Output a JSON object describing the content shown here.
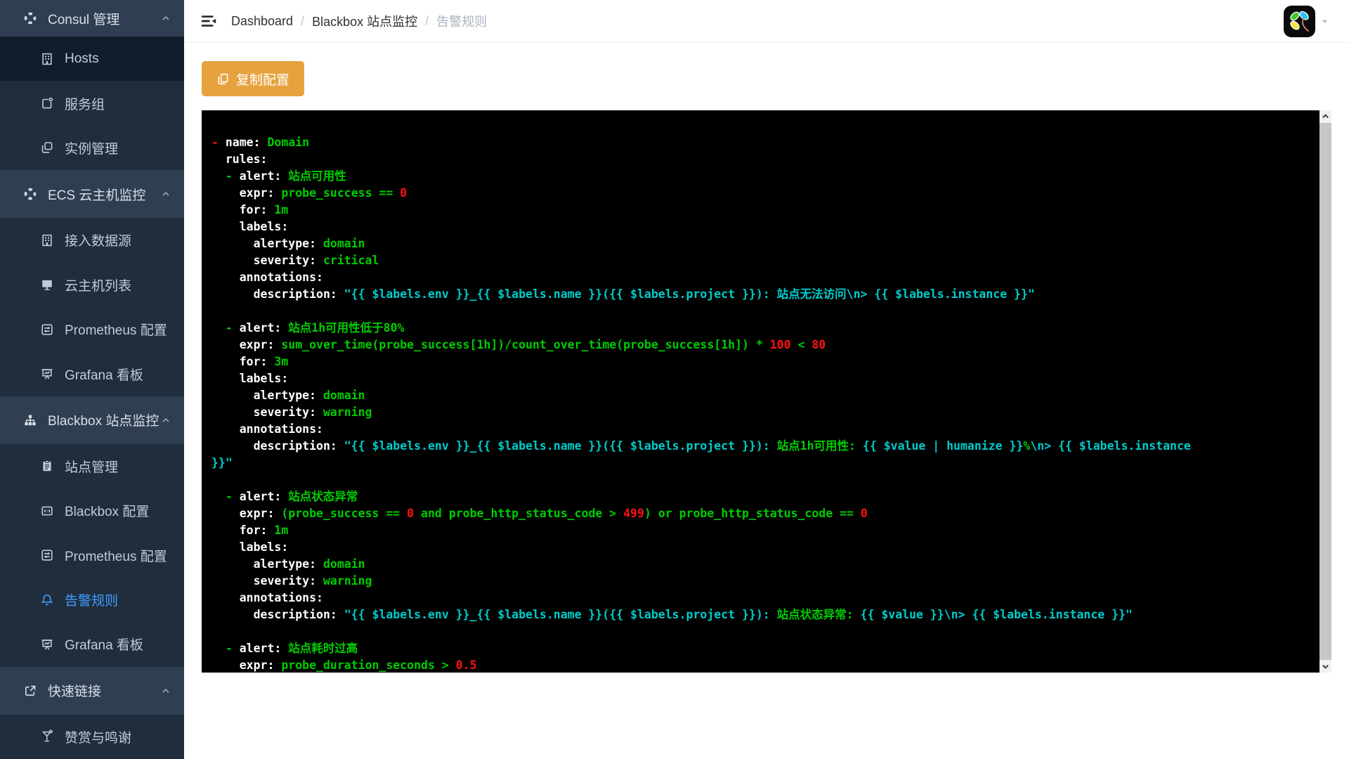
{
  "sidebar": {
    "items": [
      {
        "kind": "header",
        "id": "consul",
        "icon": "lifebuoy-icon",
        "label": "Consul 管理",
        "chevron": true,
        "first": true
      },
      {
        "kind": "item",
        "id": "hosts",
        "icon": "building-icon",
        "label": "Hosts",
        "dark": true
      },
      {
        "kind": "item",
        "id": "service-groups",
        "icon": "tag-icon",
        "label": "服务组"
      },
      {
        "kind": "item",
        "id": "instance-management",
        "icon": "copy-icon",
        "label": "实例管理"
      },
      {
        "kind": "header",
        "id": "ecs",
        "icon": "lifebuoy-icon",
        "label": "ECS 云主机监控",
        "chevron": true
      },
      {
        "kind": "item",
        "id": "datasource-access",
        "icon": "building-icon",
        "label": "接入数据源"
      },
      {
        "kind": "item",
        "id": "host-list",
        "icon": "monitor-icon",
        "label": "云主机列表"
      },
      {
        "kind": "item",
        "id": "prometheus-config-ecs",
        "icon": "sliders-icon",
        "label": "Prometheus 配置"
      },
      {
        "kind": "item",
        "id": "grafana-board-ecs",
        "icon": "board-chart-icon",
        "label": "Grafana 看板"
      },
      {
        "kind": "header",
        "id": "blackbox",
        "icon": "sitemap-icon",
        "label": "Blackbox 站点监控",
        "chevron": true
      },
      {
        "kind": "item",
        "id": "site-management",
        "icon": "clipboard-icon",
        "label": "站点管理"
      },
      {
        "kind": "item",
        "id": "blackbox-config",
        "icon": "blackbox-config-icon",
        "label": "Blackbox 配置"
      },
      {
        "kind": "item",
        "id": "prometheus-config-blackbox",
        "icon": "sliders-icon",
        "label": "Prometheus 配置"
      },
      {
        "kind": "item",
        "id": "alert-rules",
        "icon": "bell-icon",
        "label": "告警规则",
        "active": true
      },
      {
        "kind": "item",
        "id": "grafana-board-blackbox",
        "icon": "board-chart-icon",
        "label": "Grafana 看板"
      },
      {
        "kind": "header",
        "id": "quick-links",
        "icon": "external-link-icon",
        "label": "快速链接",
        "chevron": true
      },
      {
        "kind": "item",
        "id": "donate-thanks",
        "icon": "cocktail-icon",
        "label": "赞赏与鸣谢"
      }
    ]
  },
  "breadcrumb": {
    "separator": "/",
    "items": [
      {
        "label": "Dashboard",
        "muted": false
      },
      {
        "label": "Blackbox 站点监控",
        "muted": false
      },
      {
        "label": "告警规则",
        "muted": true
      }
    ]
  },
  "toolbar": {
    "copy_label": "复制配置"
  },
  "code": {
    "lines": [
      [
        [
          "r",
          "- "
        ],
        [
          "w",
          "name: "
        ],
        [
          "g",
          "Domain"
        ]
      ],
      [
        [
          "w",
          "  rules:"
        ]
      ],
      [
        [
          "w",
          "  "
        ],
        [
          "g",
          "- "
        ],
        [
          "w",
          "alert: "
        ],
        [
          "g",
          "站点可用性"
        ]
      ],
      [
        [
          "w",
          "    expr: "
        ],
        [
          "g",
          "probe_success == "
        ],
        [
          "r",
          "0"
        ]
      ],
      [
        [
          "w",
          "    for: "
        ],
        [
          "g",
          "1m"
        ]
      ],
      [
        [
          "w",
          "    labels:"
        ]
      ],
      [
        [
          "w",
          "      alertype: "
        ],
        [
          "g",
          "domain"
        ]
      ],
      [
        [
          "w",
          "      severity: "
        ],
        [
          "g",
          "critical"
        ]
      ],
      [
        [
          "w",
          "    annotations:"
        ]
      ],
      [
        [
          "w",
          "      description: "
        ],
        [
          "c",
          "\"{{ $labels.env }}_{{ $labels.name }}({{ $labels.project }}): 站点无法访问\\n> {{ $labels.instance }}\""
        ]
      ],
      [],
      [
        [
          "w",
          "  "
        ],
        [
          "g",
          "- "
        ],
        [
          "w",
          "alert: "
        ],
        [
          "g",
          "站点1h可用性低于80%"
        ]
      ],
      [
        [
          "w",
          "    expr: "
        ],
        [
          "g",
          "sum_over_time(probe_success[1h])/count_over_time(probe_success[1h]) * "
        ],
        [
          "r",
          "100"
        ],
        [
          "g",
          " < "
        ],
        [
          "r",
          "80"
        ]
      ],
      [
        [
          "w",
          "    for: "
        ],
        [
          "g",
          "3m"
        ]
      ],
      [
        [
          "w",
          "    labels:"
        ]
      ],
      [
        [
          "w",
          "      alertype: "
        ],
        [
          "g",
          "domain"
        ]
      ],
      [
        [
          "w",
          "      severity: "
        ],
        [
          "g",
          "warning"
        ]
      ],
      [
        [
          "w",
          "    annotations:"
        ]
      ],
      [
        [
          "w",
          "      description: "
        ],
        [
          "c",
          "\"{{ $labels.env }}_{{ $labels.name }}({{ $labels.project }}): "
        ],
        [
          "g",
          "站点1h可用性:"
        ],
        [
          "c",
          " {{ $value | humanize }}"
        ],
        [
          "g",
          "%"
        ],
        [
          "c",
          "\\n> {{ $labels.instance"
        ]
      ],
      [
        [
          "c",
          "}}\""
        ]
      ],
      [],
      [
        [
          "w",
          "  "
        ],
        [
          "g",
          "- "
        ],
        [
          "w",
          "alert: "
        ],
        [
          "g",
          "站点状态异常"
        ]
      ],
      [
        [
          "w",
          "    expr: "
        ],
        [
          "g",
          "(probe_success == "
        ],
        [
          "r",
          "0"
        ],
        [
          "g",
          " and probe_http_status_code > "
        ],
        [
          "r",
          "499"
        ],
        [
          "g",
          ") or probe_http_status_code == "
        ],
        [
          "r",
          "0"
        ]
      ],
      [
        [
          "w",
          "    for: "
        ],
        [
          "g",
          "1m"
        ]
      ],
      [
        [
          "w",
          "    labels:"
        ]
      ],
      [
        [
          "w",
          "      alertype: "
        ],
        [
          "g",
          "domain"
        ]
      ],
      [
        [
          "w",
          "      severity: "
        ],
        [
          "g",
          "warning"
        ]
      ],
      [
        [
          "w",
          "    annotations:"
        ]
      ],
      [
        [
          "w",
          "      description: "
        ],
        [
          "c",
          "\"{{ $labels.env }}_{{ $labels.name }}({{ $labels.project }}): "
        ],
        [
          "g",
          "站点状态异常:"
        ],
        [
          "c",
          " {{ $value }}\\n> {{ $labels.instance }}\""
        ]
      ],
      [],
      [
        [
          "w",
          "  "
        ],
        [
          "g",
          "- "
        ],
        [
          "w",
          "alert: "
        ],
        [
          "g",
          "站点耗时过高"
        ]
      ],
      [
        [
          "w",
          "    expr: "
        ],
        [
          "g",
          "probe_duration_seconds > "
        ],
        [
          "r",
          "0.5"
        ]
      ]
    ]
  },
  "colors": {
    "sidebar_bg": "#1f2d3d",
    "sidebar_header_bg": "#2f3e51",
    "sidebar_active_bg": "#121d2b",
    "accent_blue": "#409eff",
    "button_orange": "#e6a23c",
    "code_white": "#ffffff",
    "code_green": "#00cc00",
    "code_red": "#ff1111",
    "code_cyan": "#00cccc"
  }
}
